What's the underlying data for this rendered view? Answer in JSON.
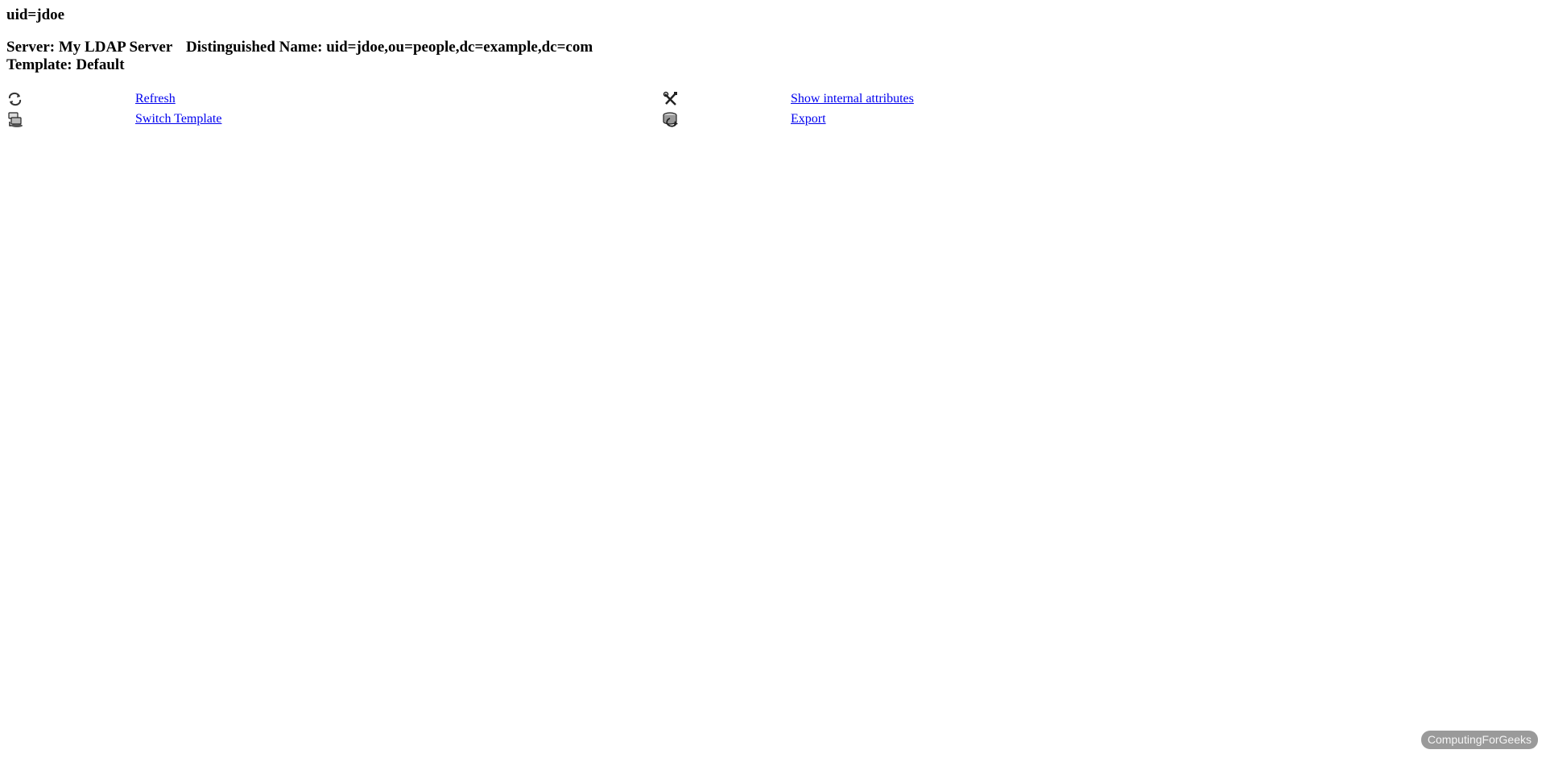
{
  "entry": {
    "title": "uid=jdoe",
    "server_text": "Server: My LDAP Server",
    "dn_text": "Distinguished Name: uid=jdoe,ou=people,dc=example,dc=com",
    "template_text": "Template: Default"
  },
  "actions": {
    "refresh": {
      "label": "Refresh",
      "icon": "refresh-icon"
    },
    "show_internal": {
      "label": "Show internal attributes",
      "icon": "tools-icon"
    },
    "switch_template": {
      "label": "Switch Template",
      "icon": "switch-template-icon"
    },
    "export": {
      "label": "Export",
      "icon": "export-icon"
    }
  },
  "watermark": {
    "text": "ComputingForGeeks"
  }
}
